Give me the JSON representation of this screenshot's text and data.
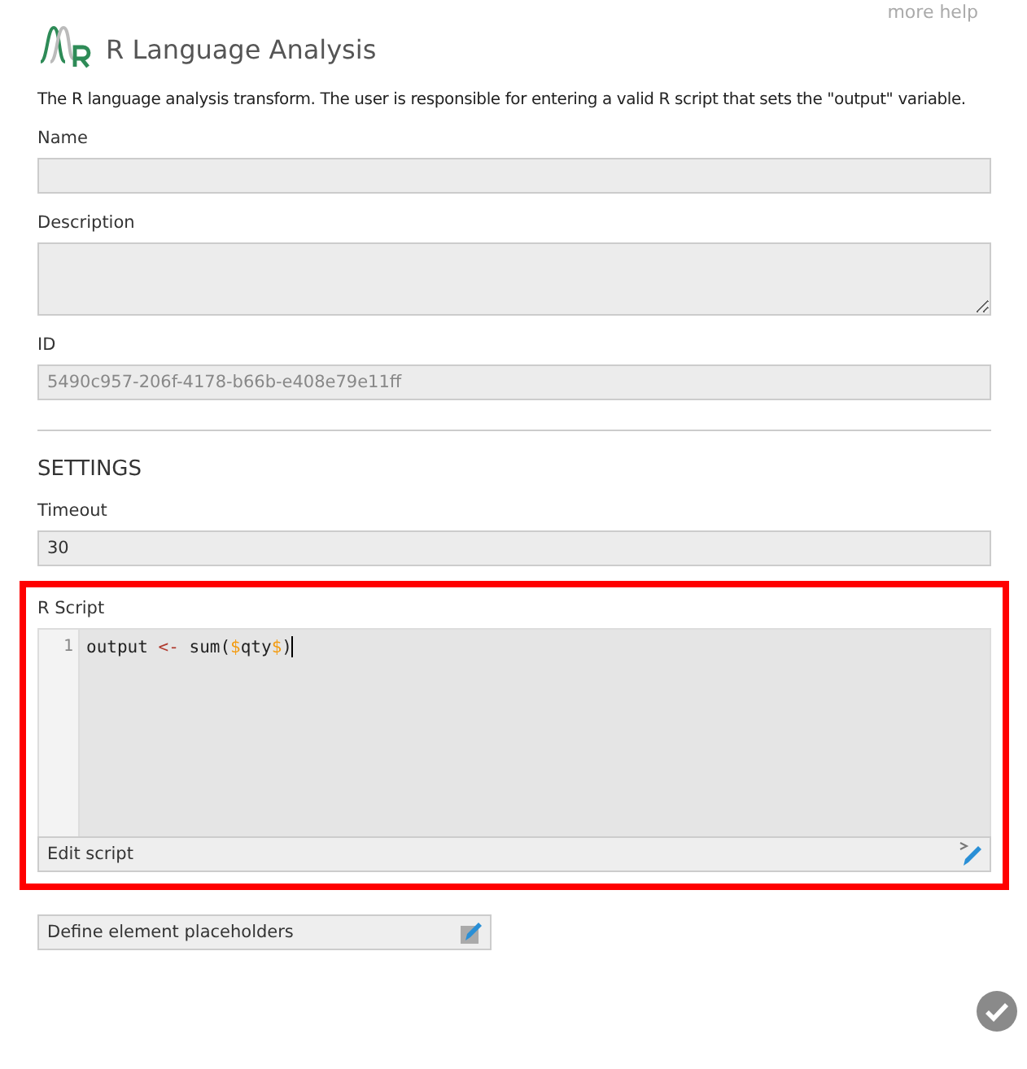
{
  "help_link": "more help",
  "title": "R Language Analysis",
  "description": "The R language analysis transform. The user is responsible for entering a valid R script that sets the \"output\" variable.",
  "fields": [
    {
      "label": "Name",
      "kind": "input"
    },
    {
      "label": "Description",
      "kind": "textarea"
    },
    {
      "label": "ID",
      "kind": "input",
      "value": "5490c957-206f-4178-b66b-e408e79e11ff"
    }
  ],
  "settings": {
    "heading": "SETTINGS",
    "timeout": {
      "label": "Timeout",
      "value": "30"
    },
    "script": {
      "label": "R Script",
      "highlighted": true,
      "line_numbers": [
        "1"
      ],
      "code": [
        [
          {
            "text": "output ",
            "kind": "plain"
          },
          {
            "text": "<-",
            "kind": "operator"
          },
          {
            "text": " sum(",
            "kind": "plain"
          },
          {
            "text": "$",
            "kind": "delimiter"
          },
          {
            "text": "qty",
            "kind": "plain"
          },
          {
            "text": "$",
            "kind": "delimiter"
          },
          {
            "text": ")",
            "kind": "plain"
          }
        ]
      ],
      "edit_button": "Edit script"
    },
    "placeholders_button": "Define element placeholders"
  }
}
